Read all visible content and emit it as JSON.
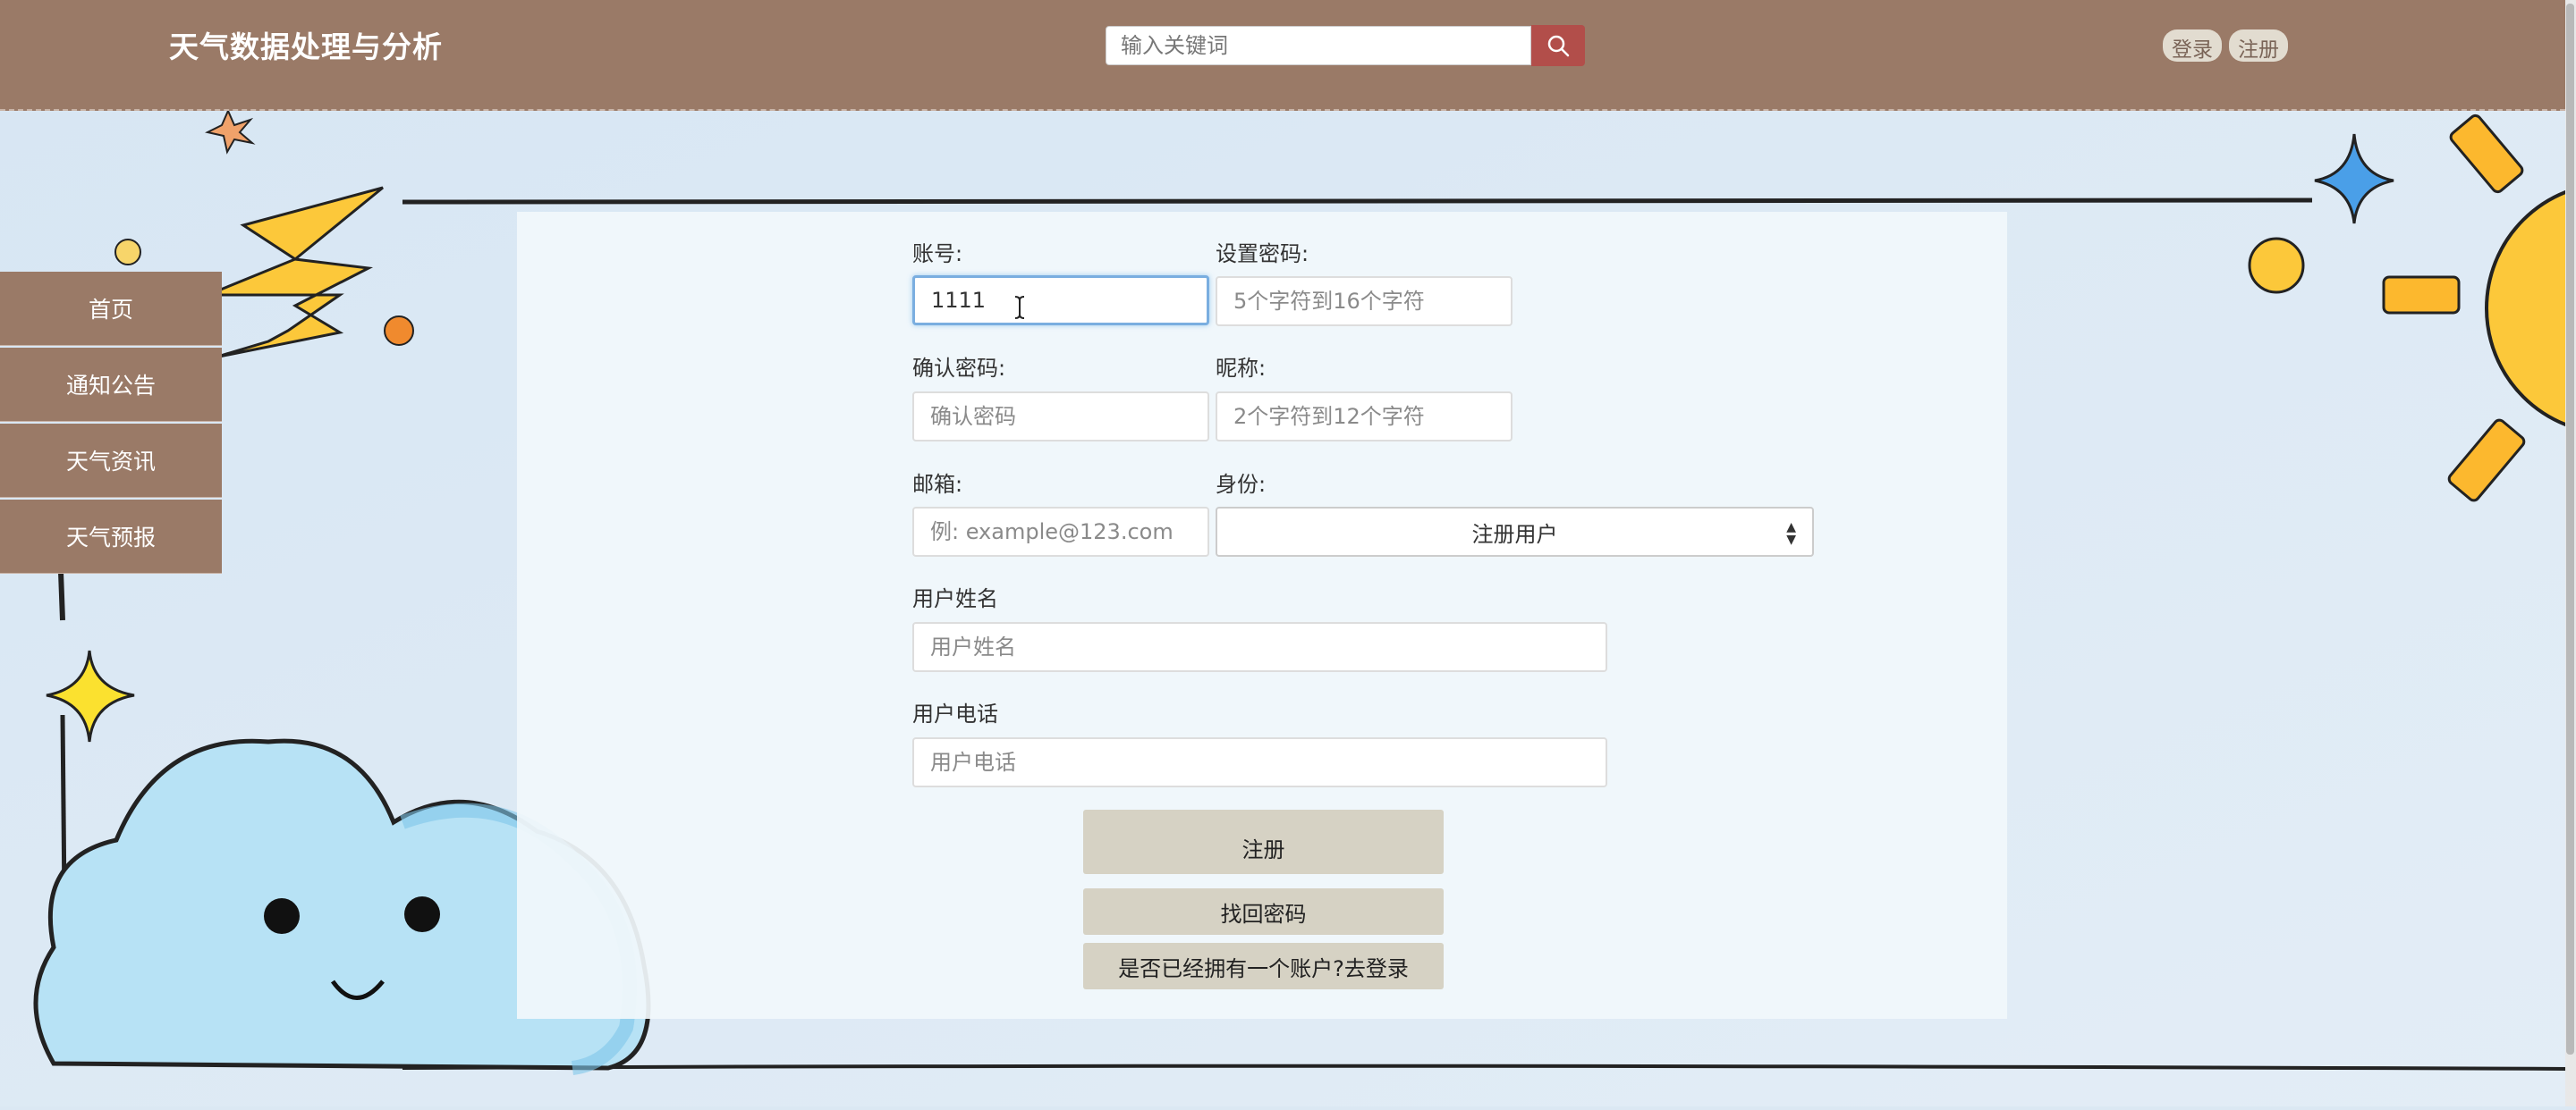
{
  "header": {
    "site_title": "天气数据处理与分析",
    "search_placeholder": "输入关键词",
    "login_label": "登录",
    "register_label": "注册"
  },
  "sidebar": {
    "items": [
      {
        "label": "首页"
      },
      {
        "label": "通知公告"
      },
      {
        "label": "天气资讯"
      },
      {
        "label": "天气预报"
      }
    ]
  },
  "form": {
    "account_label": "账号:",
    "account_value": "1111",
    "password_label": "设置密码:",
    "password_placeholder": "5个字符到16个字符",
    "confirm_label": "确认密码:",
    "confirm_placeholder": "确认密码",
    "nickname_label": "昵称:",
    "nickname_placeholder": "2个字符到12个字符",
    "email_label": "邮箱:",
    "email_placeholder": "例: example@123.com",
    "role_label": "身份:",
    "role_selected": "注册用户",
    "realname_label": "用户姓名",
    "realname_placeholder": "用户姓名",
    "phone_label": "用户电话",
    "phone_placeholder": "用户电话",
    "register_button": "注册",
    "recover_button": "找回密码",
    "login_link_button": "是否已经拥有一个账户?去登录"
  },
  "colors": {
    "header_bg": "#9a7a67",
    "search_button": "#b24e4a",
    "form_button": "#d6d2c4"
  }
}
